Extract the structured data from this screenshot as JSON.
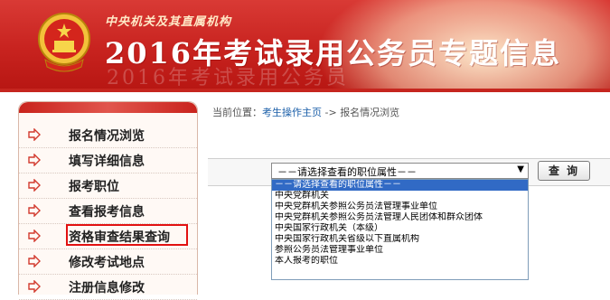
{
  "header": {
    "org_name": "中央机关及其直属机构",
    "title": "2016年考试录用公务员专题信息",
    "watermark": "2016年考试录用公务员"
  },
  "sidebar": {
    "items": [
      {
        "label": "报名情况浏览"
      },
      {
        "label": "填写详细信息"
      },
      {
        "label": "报考职位"
      },
      {
        "label": "查看报考信息"
      },
      {
        "label": "资格审查结果查询"
      },
      {
        "label": "修改考试地点"
      },
      {
        "label": "注册信息修改"
      }
    ]
  },
  "breadcrumb": {
    "prefix": "当前位置：",
    "link": "考生操作主页",
    "separator": " ->",
    "current": "报名情况浏览"
  },
  "filter": {
    "selected": "－－请选择查看的职位属性－－",
    "query_label": "查询",
    "options": [
      "－－请选择查看的职位属性－－",
      "中央党群机关",
      "中央党群机关参照公务员法管理事业单位",
      "中央党群机关参照公务员法管理人民团体和群众团体",
      "中央国家行政机关（本级）",
      "中央国家行政机关省级以下直属机构",
      "参照公务员法管理事业单位",
      "本人报考的职位"
    ]
  },
  "colors": {
    "banner_red": "#c8231f",
    "highlight_border": "#e21111",
    "link_blue": "#1a5ea8",
    "selected_option_bg": "#316ac5"
  }
}
